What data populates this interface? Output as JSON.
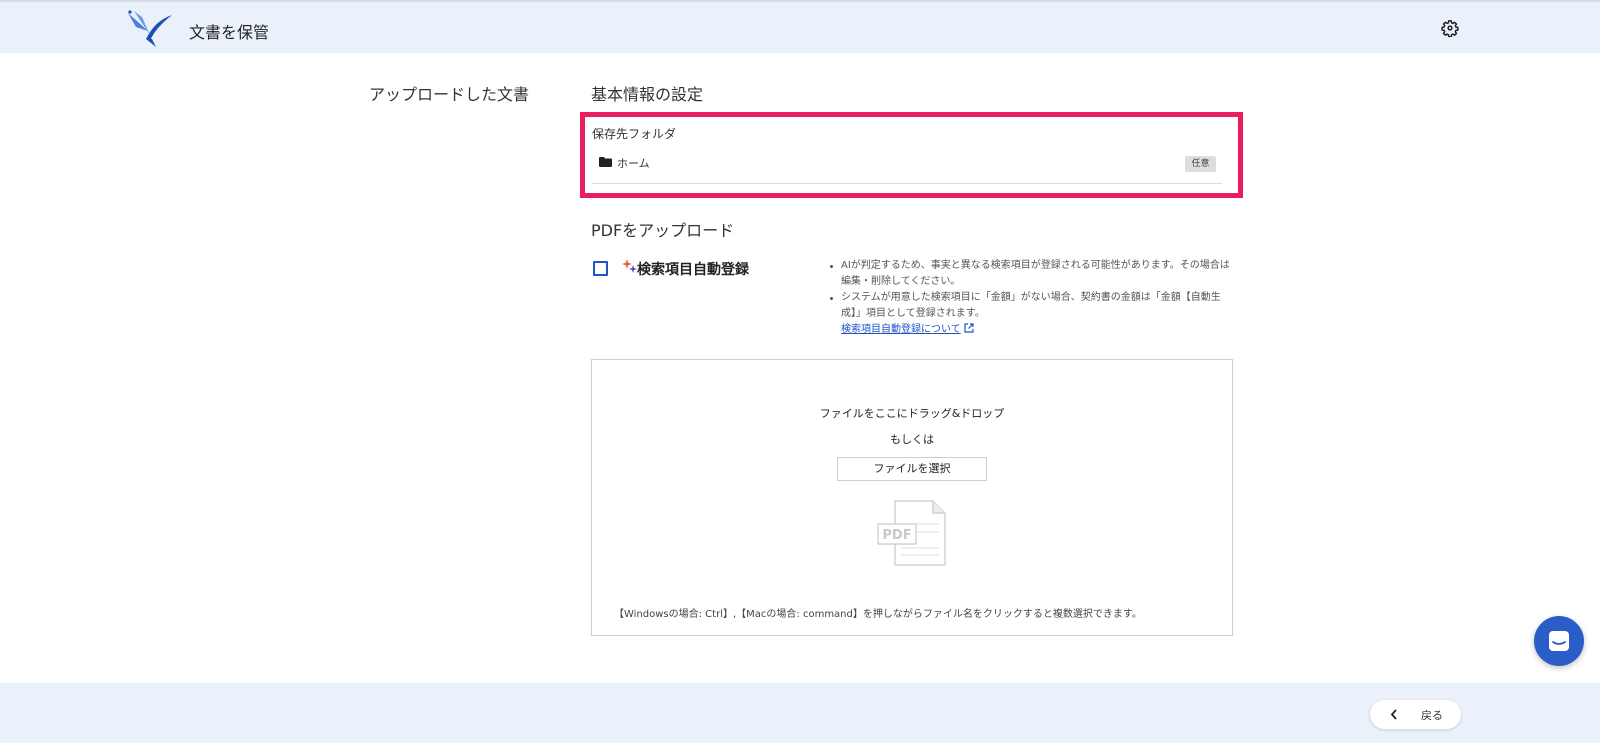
{
  "header": {
    "title": "文書を保管"
  },
  "left": {
    "heading": "アップロードした文書"
  },
  "basic_info": {
    "title": "基本情報の設定",
    "folder_label": "保存先フォルダ",
    "folder_name": "ホーム",
    "optional_badge": "任意"
  },
  "upload": {
    "title": "PDFをアップロード",
    "auto_register_label": "検索項目自動登録",
    "notes": [
      "AIが判定するため、事実と異なる検索項目が登録される可能性があります。その場合は編集・削除してください。",
      "システムが用意した検索項目に「金額」がない場合、契約書の金額は「金額【自動生成】」項目として登録されます。"
    ],
    "notes_link": "検索項目自動登録について",
    "dropzone": {
      "drag_text": "ファイルをここにドラッグ&ドロップ",
      "or_text": "もしくは",
      "select_button": "ファイルを選択",
      "pdf_label": "PDF",
      "hint": "【Windowsの場合: Ctrl】,【Macの場合: command】を押しながらファイル名をクリックすると複数選択できます。"
    }
  },
  "footer": {
    "back_label": "戻る"
  },
  "colors": {
    "accent": "#1d55c6",
    "highlight": "#ea1d5d",
    "header_bg": "#eaf1fb",
    "chat_button": "#2a5dc8"
  },
  "icons": {
    "logo": "bird-logo-icon",
    "settings": "gear-icon",
    "folder": "folder-icon",
    "sparkle": "sparkle-icon",
    "external_link": "external-link-icon",
    "back": "chevron-left-icon",
    "chat": "chat-icon"
  }
}
